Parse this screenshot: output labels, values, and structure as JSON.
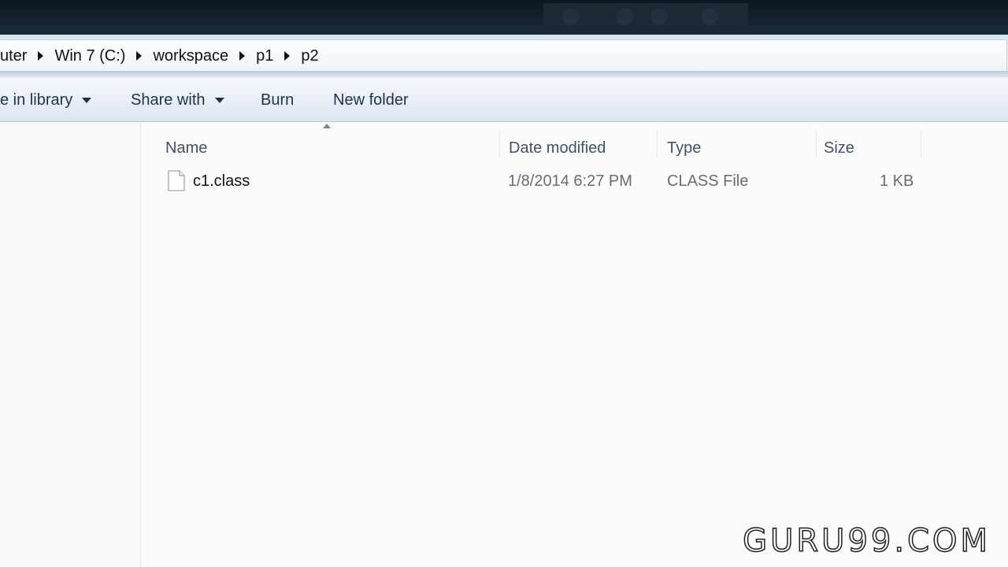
{
  "window": {
    "breadcrumbs": [
      "uter",
      "Win 7 (C:)",
      "workspace",
      "p1",
      "p2"
    ]
  },
  "toolbar": {
    "include_in_library": "e in library",
    "share_with": "Share with",
    "burn": "Burn",
    "new_folder": "New folder"
  },
  "columns": {
    "name": "Name",
    "date_modified": "Date modified",
    "type": "Type",
    "size": "Size"
  },
  "files": [
    {
      "name": "c1.class",
      "date_modified": "1/8/2014 6:27 PM",
      "type": "CLASS File",
      "size": "1 KB",
      "icon": "generic-file-icon"
    }
  ],
  "watermark": "GURU99.COM",
  "colors": {
    "titlebar": "#16222e",
    "toolbar_text": "#1e3050",
    "header_text": "#3c5270"
  }
}
